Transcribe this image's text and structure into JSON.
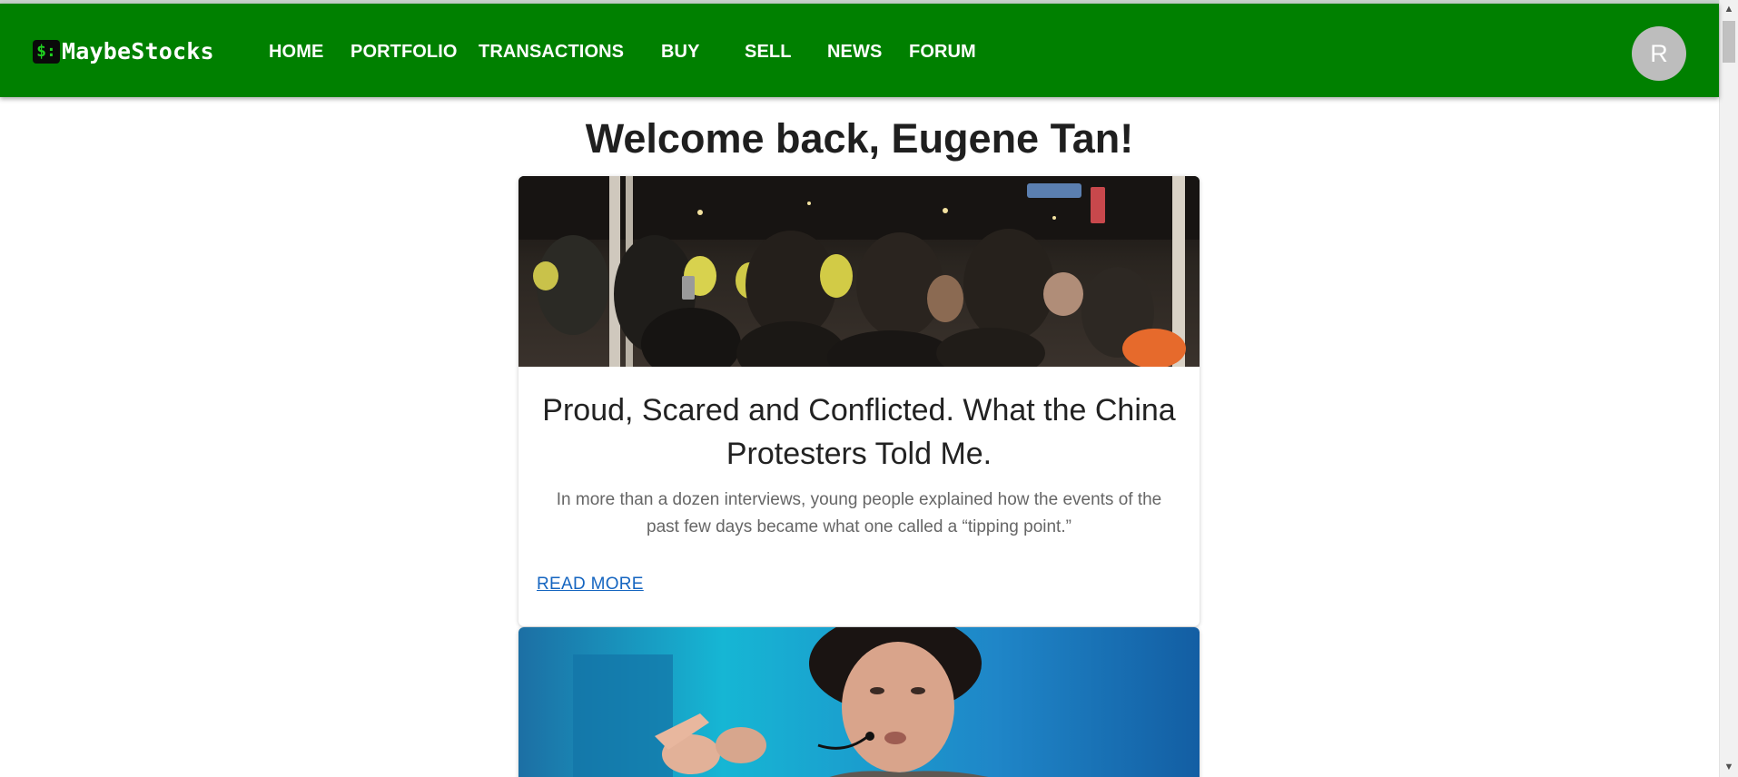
{
  "app": {
    "brand_icon": "$:",
    "brand_name": "MaybeStocks"
  },
  "nav": {
    "items": [
      {
        "label": "HOME"
      },
      {
        "label": "PORTFOLIO"
      },
      {
        "label": "TRANSACTIONS"
      },
      {
        "label": "BUY"
      },
      {
        "label": "SELL"
      },
      {
        "label": "NEWS"
      },
      {
        "label": "FORUM"
      }
    ],
    "avatar_initial": "R"
  },
  "main": {
    "welcome": "Welcome back, Eugene Tan!",
    "articles": [
      {
        "title": "Proud, Scared and Conflicted. What the China Protesters Told Me.",
        "description": "In more than a dozen interviews, young people explained how the events of the past few days became what one called a “tipping point.”",
        "read_more": "READ MORE"
      }
    ]
  },
  "colors": {
    "navbar": "#008000",
    "link": "#1565c0",
    "avatar": "#bdbdbd"
  },
  "icons": {
    "brand": "dollar-terminal-icon",
    "scroll_up": "chevron-up-icon",
    "scroll_down": "chevron-down-icon"
  }
}
